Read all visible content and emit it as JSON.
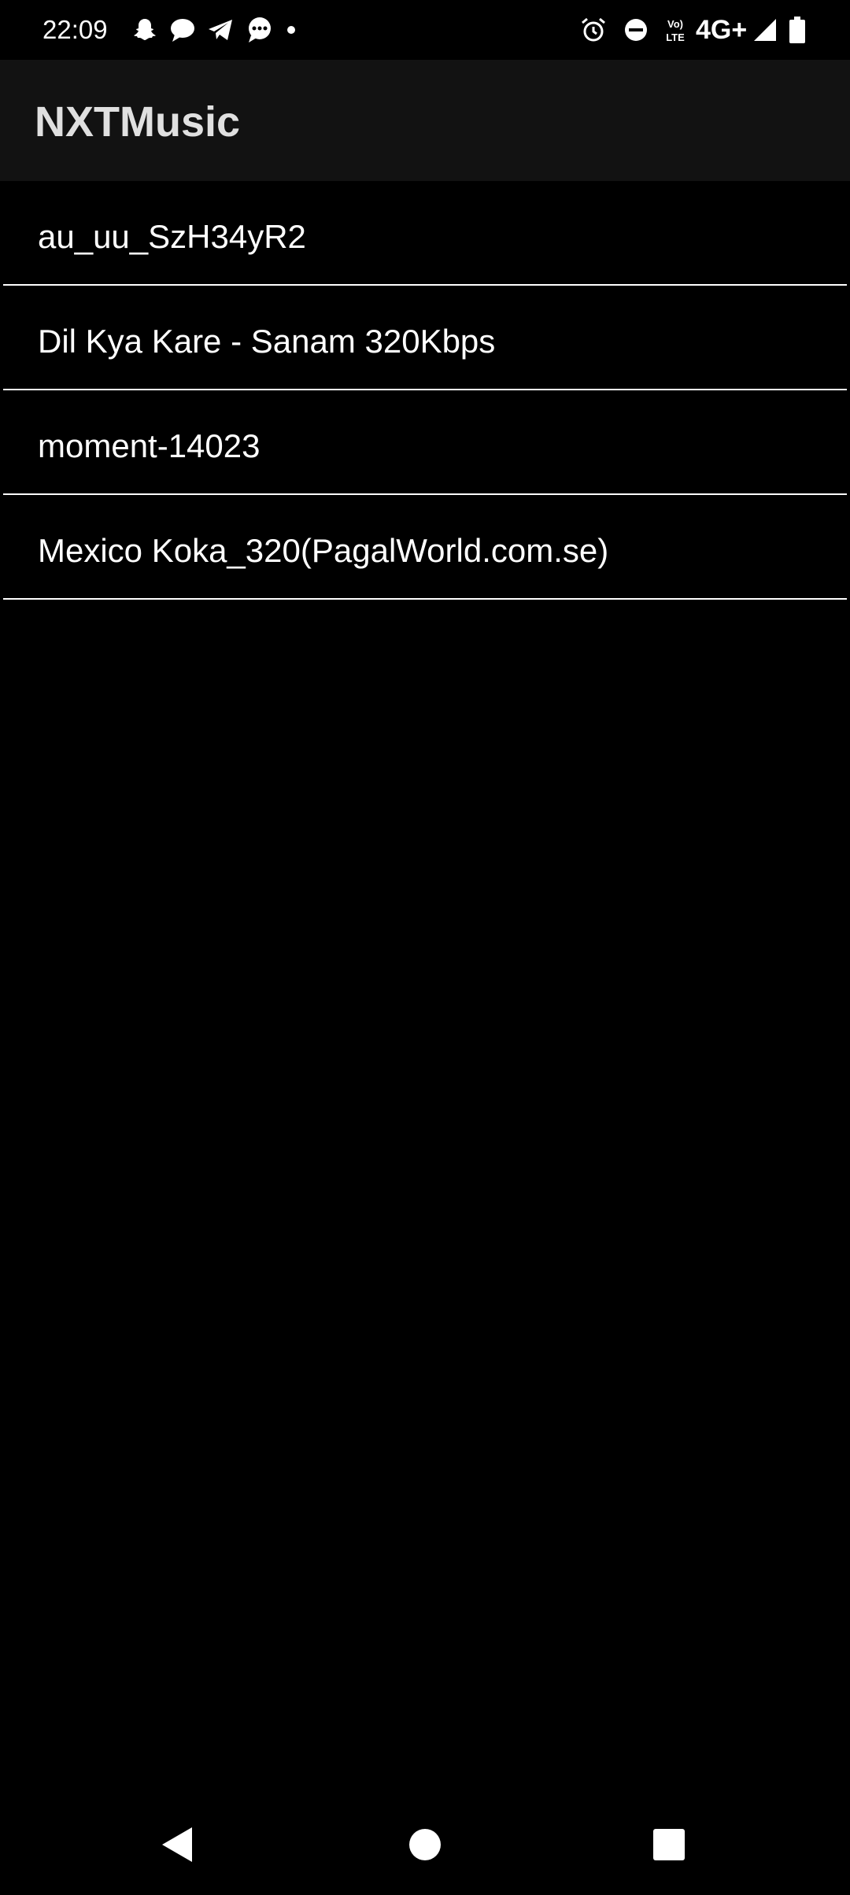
{
  "status_bar": {
    "time": "22:09",
    "network": "4G+",
    "icons": [
      "snapchat-icon",
      "message-icon",
      "telegram-icon",
      "chat-icon",
      "dot-icon",
      "alarm-icon",
      "dnd-icon",
      "volte-icon",
      "signal-icon",
      "battery-icon"
    ]
  },
  "app_bar": {
    "title": "NXTMusic"
  },
  "songs": [
    {
      "title": "au_uu_SzH34yR2"
    },
    {
      "title": "Dil Kya Kare - Sanam 320Kbps"
    },
    {
      "title": "moment-14023"
    },
    {
      "title": "Mexico Koka_320(PagalWorld.com.se)"
    }
  ],
  "nav_bar": {
    "buttons": [
      "back-icon",
      "home-icon",
      "recents-icon"
    ]
  },
  "colors": {
    "background": "#000000",
    "app_bar": "#121212",
    "divider": "#ffffff",
    "text": "#ffffff"
  }
}
